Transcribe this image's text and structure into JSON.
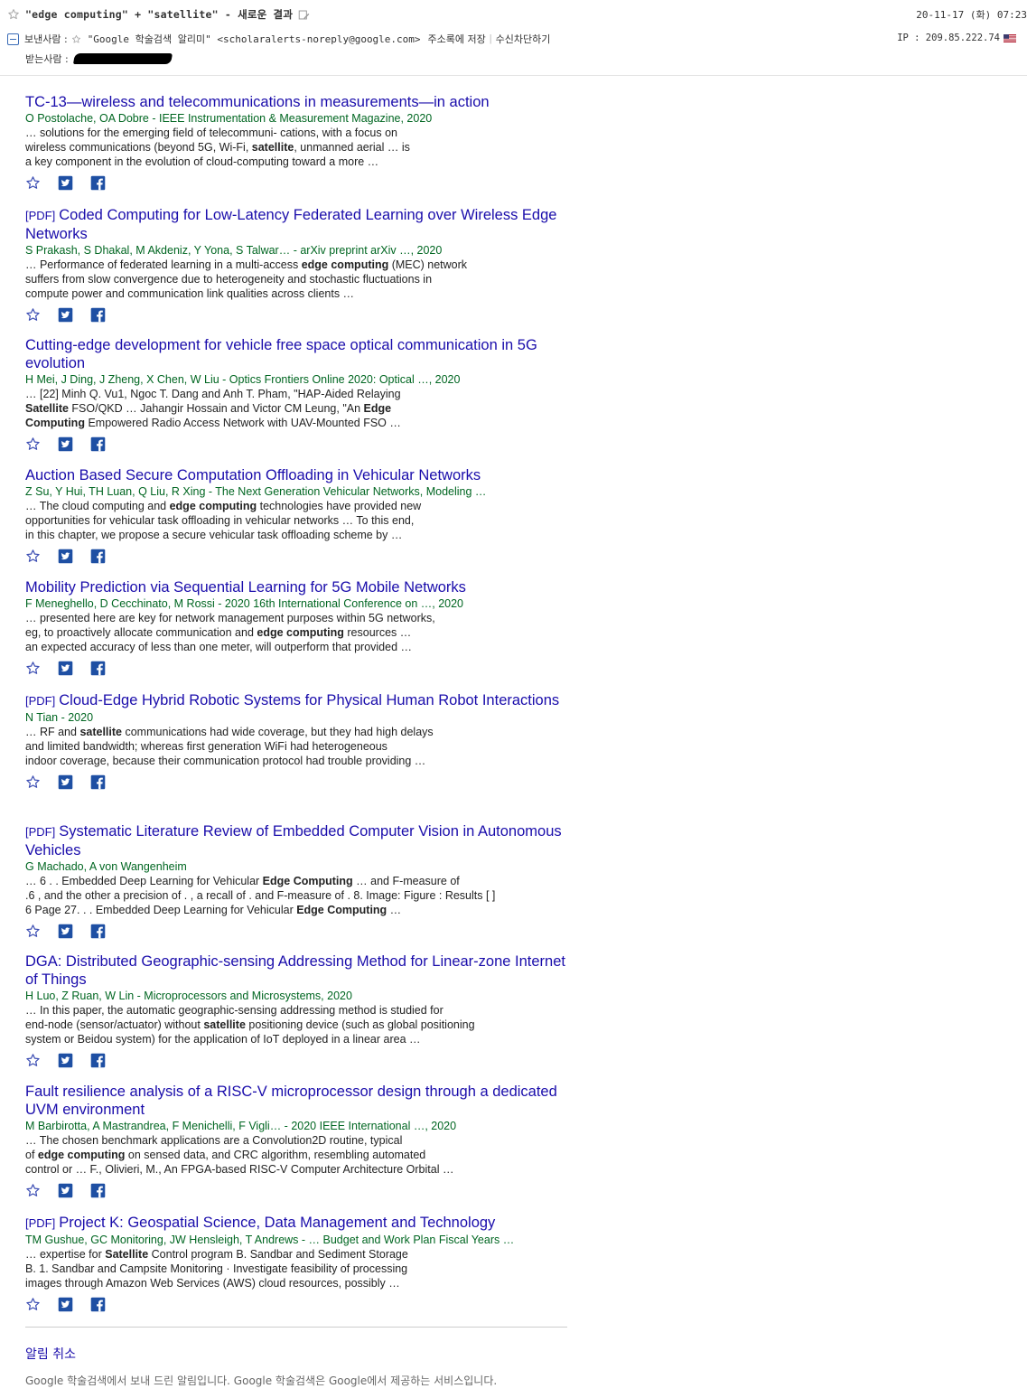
{
  "header": {
    "subject": "\"edge computing\" + \"satellite\" - 새로운 결과",
    "date": "20-11-17 (화) 07:23",
    "from_label": "보낸사람 :",
    "from_sender": "\"Google 학술검색 알리미\" <scholaralerts-noreply@google.com>",
    "address_book_link": "주소록에 저장",
    "separator": "|",
    "block_link": "수신차단하기",
    "ip": "IP : 209.85.222.74",
    "to_label": "받는사람 :",
    "icons": {
      "subject_star": "star-outline-icon",
      "memo": "memo-icon",
      "collapse": "collapse-icon",
      "flag": "us-flag-icon"
    }
  },
  "results": [
    {
      "pdf": "",
      "title": "TC-13—wireless and telecommunications in measurements—in action",
      "authors": "O Postolache, OA Dobre - IEEE Instrumentation & Measurement Magazine, 2020",
      "snippet": [
        [
          "… solutions for the emerging field of telecommuni- cations, with a focus on"
        ],
        [
          "wireless communications (beyond 5G, Wi-Fi, ",
          {
            "b": "satellite"
          },
          ", unmanned aerial … is"
        ],
        [
          "a key component in the evolution of cloud-computing toward a more …"
        ]
      ]
    },
    {
      "pdf": "[PDF]",
      "title": "Coded Computing for Low-Latency Federated Learning over Wireless Edge Networks",
      "authors": "S Prakash, S Dhakal, M Akdeniz, Y Yona, S Talwar… - arXiv preprint arXiv …, 2020",
      "snippet": [
        [
          "… Performance of federated learning in a multi-access ",
          {
            "b": "edge computing"
          },
          " (MEC) network"
        ],
        [
          "suffers from slow convergence due to heterogeneity and stochastic fluctuations in"
        ],
        [
          "compute power and communication link qualities across clients …"
        ]
      ]
    },
    {
      "pdf": "",
      "title": "Cutting-edge development for vehicle free space optical communication in 5G evolution",
      "authors": "H Mei, J Ding, J Zheng, X Chen, W Liu - Optics Frontiers Online 2020: Optical …, 2020",
      "snippet": [
        [
          "… [22] Minh Q. Vu1, Ngoc T. Dang and Anh T. Pham, \"HAP-Aided Relaying"
        ],
        [
          {
            "b": "Satellite"
          },
          " FSO/QKD … Jahangir Hossain and Victor CM Leung, \"An ",
          {
            "b": "Edge"
          }
        ],
        [
          {
            "b": "Computing"
          },
          " Empowered Radio Access Network with UAV-Mounted FSO …"
        ]
      ]
    },
    {
      "pdf": "",
      "title": "Auction Based Secure Computation Offloading in Vehicular Networks",
      "authors": "Z Su, Y Hui, TH Luan, Q Liu, R Xing - The Next Generation Vehicular Networks, Modeling …",
      "snippet": [
        [
          "… The cloud computing and ",
          {
            "b": "edge computing"
          },
          " technologies have provided new"
        ],
        [
          "opportunities for vehicular task offloading in vehicular networks … To this end,"
        ],
        [
          "in this chapter, we propose a secure vehicular task offloading scheme by …"
        ]
      ]
    },
    {
      "pdf": "",
      "title": "Mobility Prediction via Sequential Learning for 5G Mobile Networks",
      "authors": "F Meneghello, D Cecchinato, M Rossi - 2020 16th International Conference on …, 2020",
      "snippet": [
        [
          "… presented here are key for network management purposes within 5G networks,"
        ],
        [
          "eg, to proactively allocate communication and ",
          {
            "b": "edge computing"
          },
          " resources …"
        ],
        [
          "an expected accuracy of less than one meter, will outperform that provided …"
        ]
      ]
    },
    {
      "pdf": "[PDF]",
      "title": "Cloud-Edge Hybrid Robotic Systems for Physical Human Robot Interactions",
      "authors": "N Tian - 2020",
      "snippet": [
        [
          "… RF and ",
          {
            "b": "satellite"
          },
          " communications had wide coverage, but they had high delays"
        ],
        [
          "and limited bandwidth; whereas first generation WiFi had heterogeneous"
        ],
        [
          "indoor coverage, because their communication protocol had trouble providing …"
        ]
      ]
    },
    {
      "pdf": "[PDF]",
      "title": "Systematic Literature Review of Embedded Computer Vision in Autonomous Vehicles",
      "authors": "G Machado, A von Wangenheim",
      "snippet": [
        [
          "… 6 . . Embedded Deep Learning for Vehicular ",
          {
            "b": "Edge Computing"
          },
          " … and F-measure of"
        ],
        [
          ".6 , and the other a precision of . , a recall of . and F-measure of . 8. Image: Figure : Results [ ]"
        ],
        [
          "6 Page 27. . . Embedded Deep Learning for Vehicular ",
          {
            "b": "Edge Computing"
          },
          " …"
        ]
      ]
    },
    {
      "pdf": "",
      "title": "DGA: Distributed Geographic-sensing Addressing Method for Linear-zone Internet of Things",
      "authors": "H Luo, Z Ruan, W Lin - Microprocessors and Microsystems, 2020",
      "snippet": [
        [
          "… In this paper, the automatic geographic-sensing addressing method is studied for"
        ],
        [
          "end-node (sensor/actuator) without ",
          {
            "b": "satellite"
          },
          " positioning device (such as global positioning"
        ],
        [
          "system or Beidou system) for the application of IoT deployed in a linear area …"
        ]
      ]
    },
    {
      "pdf": "",
      "title": "Fault resilience analysis of a RISC-V microprocessor design through a dedicated UVM environment",
      "authors": "M Barbirotta, A Mastrandrea, F Menichelli, F Vigli… - 2020 IEEE International …, 2020",
      "snippet": [
        [
          "… The chosen benchmark applications are a Convolution2D routine, typical"
        ],
        [
          "of ",
          {
            "b": "edge computing"
          },
          " on sensed data, and CRC algorithm, resembling automated"
        ],
        [
          "control or … F., Olivieri, M., An FPGA-based RISC-V Computer Architecture Orbital …"
        ]
      ]
    },
    {
      "pdf": "[PDF]",
      "title": "Project K: Geospatial Science, Data Management and Technology",
      "authors": "TM Gushue, GC Monitoring, JW Hensleigh, T Andrews - … Budget and Work Plan Fiscal Years …",
      "snippet": [
        [
          "… expertise for ",
          {
            "b": "Satellite"
          },
          " Control program B. Sandbar and Sediment Storage"
        ],
        [
          "B. 1. Sandbar and Campsite Monitoring · Investigate feasibility of processing"
        ],
        [
          "images through Amazon Web Services (AWS) cloud resources, possibly …"
        ]
      ]
    }
  ],
  "result_actions": [
    {
      "icon": "star-icon",
      "color": "#3b4db3"
    },
    {
      "icon": "twitter-icon",
      "color": "#1e4fa3"
    },
    {
      "icon": "facebook-icon",
      "color": "#1e4fa3"
    }
  ],
  "footer": {
    "cancel_label": "알림 취소",
    "note": "Google 학술검색에서 보내 드린 알림입니다. Google 학술검색은 Google에서 제공하는 서비스입니다."
  },
  "colors": {
    "link": "#1a0dab",
    "authors": "#006621",
    "snippet": "#222222",
    "muted": "#666666"
  }
}
